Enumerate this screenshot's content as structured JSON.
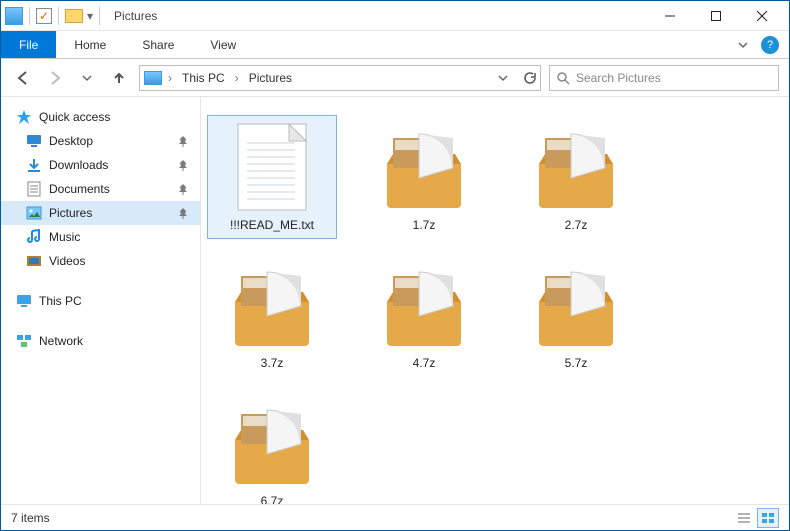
{
  "titlebar": {
    "title": "Pictures"
  },
  "ribbon": {
    "file": "File",
    "tabs": [
      "Home",
      "Share",
      "View"
    ]
  },
  "breadcrumb": {
    "root": "This PC",
    "current": "Pictures"
  },
  "search": {
    "placeholder": "Search Pictures"
  },
  "nav": {
    "quick_access": "Quick access",
    "items": [
      {
        "label": "Desktop",
        "pinned": true
      },
      {
        "label": "Downloads",
        "pinned": true
      },
      {
        "label": "Documents",
        "pinned": true
      },
      {
        "label": "Pictures",
        "pinned": true,
        "selected": true
      },
      {
        "label": "Music",
        "pinned": false
      },
      {
        "label": "Videos",
        "pinned": false
      }
    ],
    "this_pc": "This PC",
    "network": "Network"
  },
  "files": [
    {
      "name": "!!!READ_ME.txt",
      "type": "txt",
      "selected": true
    },
    {
      "name": "1.7z",
      "type": "archive"
    },
    {
      "name": "2.7z",
      "type": "archive"
    },
    {
      "name": "3.7z",
      "type": "archive"
    },
    {
      "name": "4.7z",
      "type": "archive"
    },
    {
      "name": "5.7z",
      "type": "archive"
    },
    {
      "name": "6.7z",
      "type": "archive"
    }
  ],
  "status": {
    "count": "7 items"
  }
}
